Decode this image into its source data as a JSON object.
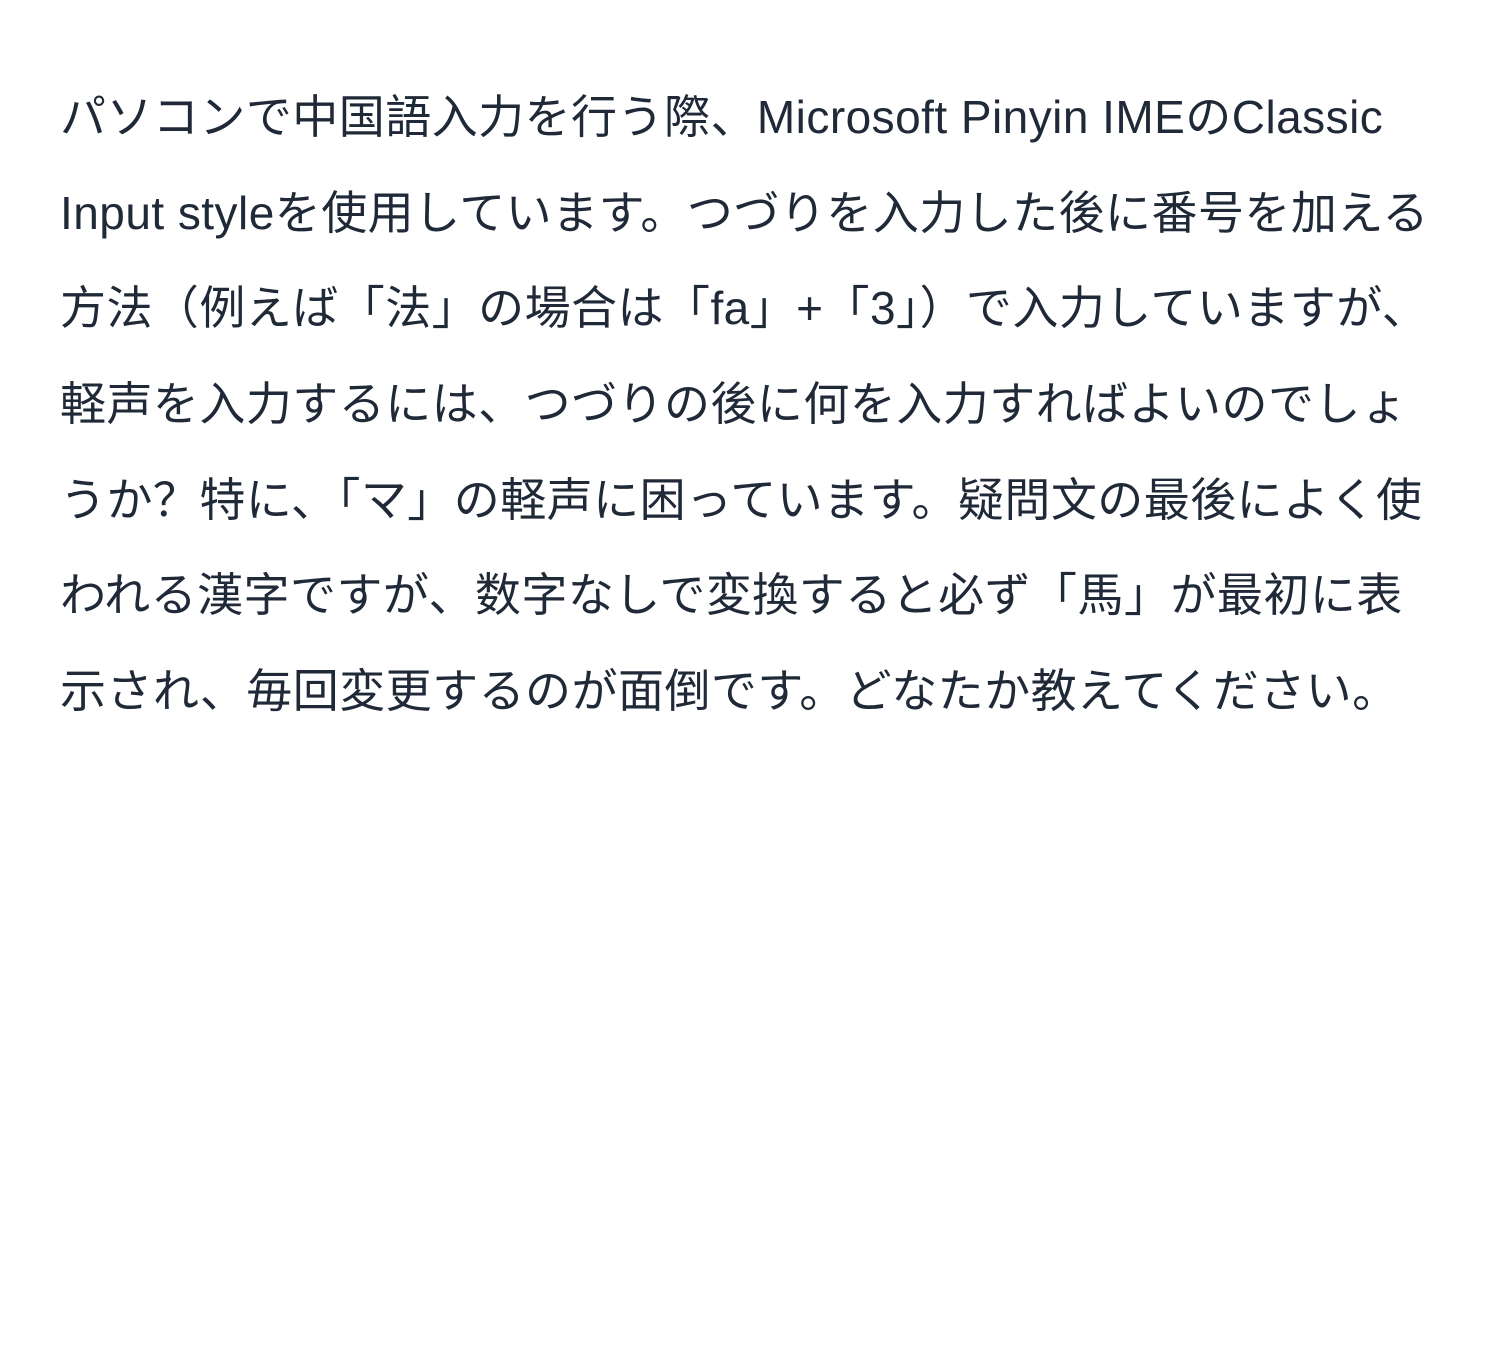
{
  "document": {
    "body_text": "パソコンで中国語入力を行う際、Microsoft Pinyin IMEのClassic Input styleを使用しています。つづりを入力した後に番号を加える方法（例えば「法」の場合は「fa」+「3」）で入力していますが、軽声を入力するには、つづりの後に何を入力すればよいのでしょうか？特に、「マ」の軽声に困っています。疑問文の最後によく使われる漢字ですが、数字なしで変換すると必ず「馬」が最初に表示され、毎回変更するのが面倒です。どなたか教えてください。"
  }
}
